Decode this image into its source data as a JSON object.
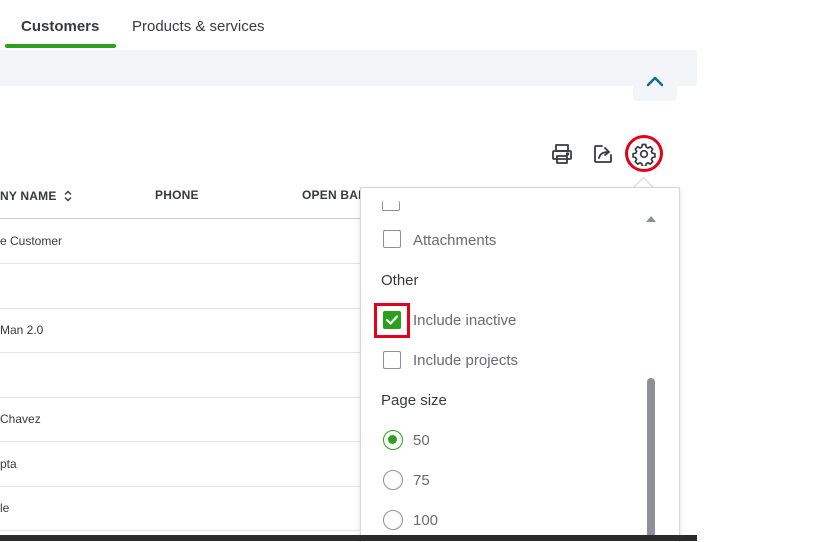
{
  "tabs": [
    {
      "label": "Customers",
      "active": true
    },
    {
      "label": "Products & services",
      "active": false
    }
  ],
  "colors": {
    "accent": "#2ca01c",
    "highlight": "#e2001a",
    "band": "#f4f5f8"
  },
  "toolbar": {
    "icons": [
      "print-icon",
      "export-icon",
      "gear-icon"
    ]
  },
  "table": {
    "columns": [
      "NY NAME",
      "PHONE",
      "OPEN BAL"
    ],
    "rows": [
      "e Customer",
      "",
      "Man 2.0",
      "",
      "Chavez",
      "pta",
      "le"
    ]
  },
  "settings_panel": {
    "checkboxes_top": [
      {
        "label": "Attachments",
        "checked": false
      }
    ],
    "other_heading": "Other",
    "other_options": [
      {
        "label": "Include inactive",
        "checked": true
      },
      {
        "label": "Include projects",
        "checked": false
      }
    ],
    "page_size_heading": "Page size",
    "page_sizes": [
      {
        "label": "50",
        "selected": true
      },
      {
        "label": "75",
        "selected": false
      },
      {
        "label": "100",
        "selected": false
      }
    ]
  }
}
